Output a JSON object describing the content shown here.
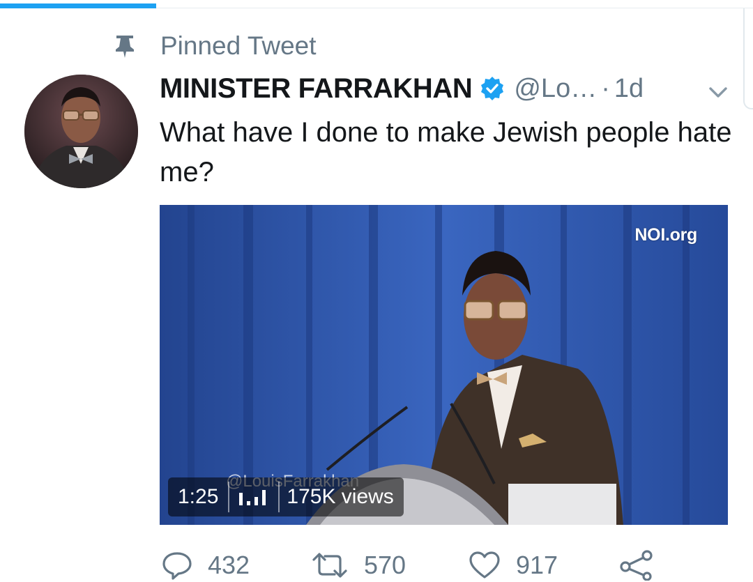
{
  "pinned": {
    "label": "Pinned Tweet",
    "icon": "pin-icon"
  },
  "author": {
    "display_name": "MINISTER FARRAKHAN",
    "handle": "@Lo…",
    "verified_icon": "verified-badge-icon",
    "verified_color": "#1da1f2"
  },
  "tweet": {
    "separator": "·",
    "timestamp": "1d",
    "text": "What have I done to make Jewish people hate me?"
  },
  "media": {
    "watermark": "NOI.org",
    "handle_watermark": "@LouisFarrakhan",
    "duration": "1:25",
    "views": "175K views",
    "views_icon": "bar-chart-icon"
  },
  "actions": {
    "reply_count": "432",
    "retweet_count": "570",
    "like_count": "917"
  },
  "colors": {
    "accent": "#1da1f2",
    "secondary_text": "#657786",
    "primary_text": "#14171a"
  }
}
